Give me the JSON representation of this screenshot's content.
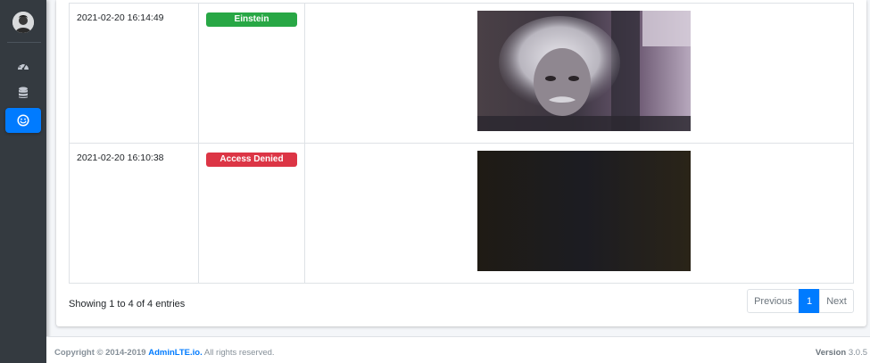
{
  "sidebar": {
    "avatar": "user-avatar",
    "items": [
      {
        "icon": "dashboard-icon",
        "active": false
      },
      {
        "icon": "database-icon",
        "active": false
      },
      {
        "icon": "smile-icon",
        "active": true
      }
    ]
  },
  "table": {
    "rows": [
      {
        "timestamp": "2021-02-20 16:14:49",
        "status": "Einstein",
        "status_color": "#28a745",
        "image": "einstein-face-snapshot"
      },
      {
        "timestamp": "2021-02-20 16:10:38",
        "status": "Access Denied",
        "status_color": "#dc3545",
        "image": "dark-camera-snapshot"
      }
    ]
  },
  "pagination": {
    "info": "Showing 1 to 4 of 4 entries",
    "previous": "Previous",
    "current": "1",
    "next": "Next"
  },
  "footer": {
    "copyright_prefix": "Copyright © 2014-2019",
    "brand": "AdminLTE.io.",
    "rights": "All rights reserved.",
    "version_label": "Version",
    "version": "3.0.5"
  },
  "colors": {
    "sidebar": "#343a40",
    "primary": "#007bff",
    "success": "#28a745",
    "danger": "#dc3545"
  }
}
